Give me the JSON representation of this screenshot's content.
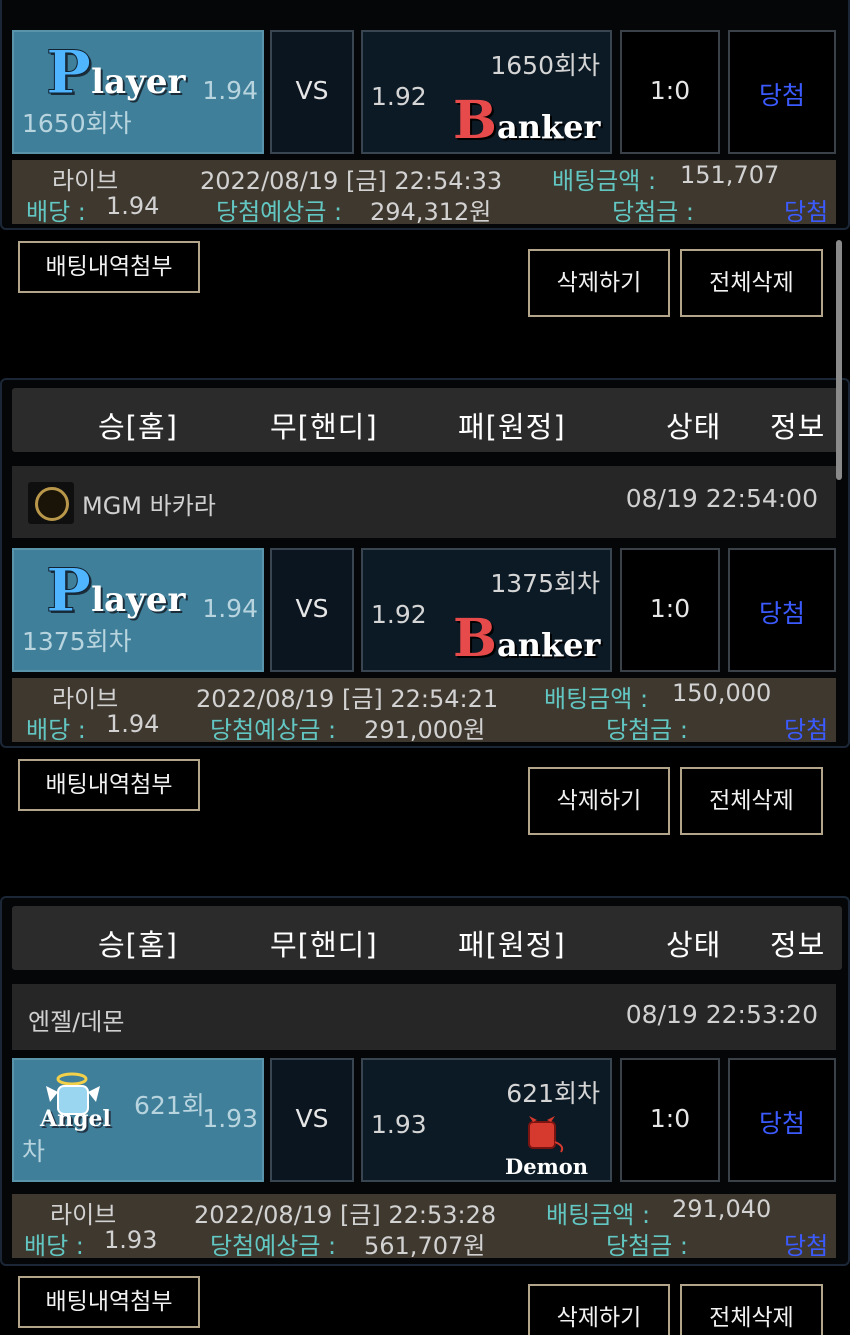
{
  "header_cols": [
    "승[홈]",
    "무[핸디]",
    "패[원정]",
    "상태",
    "정보"
  ],
  "buttons": {
    "attach": "배팅내역첨부",
    "delete": "삭제하기",
    "delete_all": "전체삭제"
  },
  "labels": {
    "vs": "VS",
    "live": "라이브",
    "bet_amount": "배팅금액 :",
    "odds": "배당 :",
    "expected_win": "당첨예상금 :",
    "win_amount": "당첨금 :"
  },
  "bets": [
    {
      "player_logo": {
        "first": "P",
        "rest": "layer"
      },
      "banker_logo": {
        "first": "B",
        "rest": "anker"
      },
      "player_odds": "1.94",
      "player_round": "1650회차",
      "banker_round": "1650회차",
      "banker_odds": "1.92",
      "score": "1:0",
      "result": "당첨",
      "datetime": "2022/08/19 [금] 22:54:33",
      "bet_amount": "151,707",
      "odds": "1.94",
      "expected": "294,312원",
      "status": "당첨"
    },
    {
      "game": "MGM 바카라",
      "game_time": "08/19 22:54:00",
      "player_logo": {
        "first": "P",
        "rest": "layer"
      },
      "banker_logo": {
        "first": "B",
        "rest": "anker"
      },
      "player_odds": "1.94",
      "player_round": "1375회차",
      "banker_round": "1375회차",
      "banker_odds": "1.92",
      "score": "1:0",
      "result": "당첨",
      "datetime": "2022/08/19 [금] 22:54:21",
      "bet_amount": "150,000",
      "odds": "1.94",
      "expected": "291,000원",
      "status": "당첨"
    },
    {
      "game": "엔젤/데몬",
      "game_time": "08/19 22:53:20",
      "player_label": "Angel",
      "banker_label": "Demon",
      "player_round_a": "621회",
      "player_round_b": "차",
      "player_odds": "1.93",
      "banker_round": "621회차",
      "banker_odds": "1.93",
      "score": "1:0",
      "result": "당첨",
      "datetime": "2022/08/19 [금] 22:53:28",
      "bet_amount": "291,040",
      "odds": "1.93",
      "expected": "561,707원",
      "status": "당첨"
    }
  ]
}
